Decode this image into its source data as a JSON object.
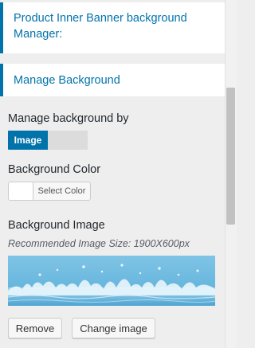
{
  "sections": {
    "product_banner_title": "Product Inner Banner background Manager:",
    "manage_background_title": "Manage Background"
  },
  "manage_by": {
    "label": "Manage background by",
    "selected_option": "Image"
  },
  "background_color": {
    "label": "Background Color",
    "button_label": "Select Color",
    "swatch_color": "#ffffff"
  },
  "background_image": {
    "label": "Background Image",
    "hint": "Recommended Image Size: 1900X600px"
  },
  "actions": {
    "remove_label": "Remove",
    "change_label": "Change image"
  },
  "colors": {
    "accent": "#0073aa",
    "panel_bg": "#eeeeee"
  }
}
